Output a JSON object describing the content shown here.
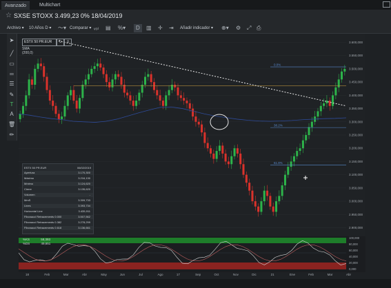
{
  "tabs": [
    {
      "label": "Avanzado",
      "active": true
    },
    {
      "label": "Multichart",
      "active": false
    }
  ],
  "title": "SXSE STOXX 3.499,23 0% 18/04/2019",
  "toolbar": {
    "archivos": "Archivo",
    "periodo": "10 Años D",
    "comparar": "Comparar",
    "indicador": "Añadir indicador",
    "active_tool": "D"
  },
  "legend": {
    "symbol": "ESTX 50 PR.EUR",
    "sma": "SMA (200,0)"
  },
  "panel": {
    "symbol": "ESTX 50 PR.EUR",
    "date": "06/02/2019",
    "rows": [
      {
        "k": "Apertura",
        "v": "3.170,300"
      },
      {
        "k": "Máximo",
        "v": "3.216,130"
      },
      {
        "k": "Mínimo",
        "v": "3.124,620"
      },
      {
        "k": "Cierre",
        "v": "3.135,620"
      },
      {
        "k": "Volumen",
        "v": "-"
      },
      {
        "k": "MmS",
        "v": "3.309,733"
      },
      {
        "k": "Lines",
        "v": "3.393,734"
      },
      {
        "k": "Horizontal Line",
        "v": "3.435,911"
      },
      {
        "k": "Fibonacci Retracements 0.000",
        "v": "3.507,562"
      },
      {
        "k": "Fibonacci Retracements 0.382",
        "v": "3.278,299"
      },
      {
        "k": "Fibonacci Retracements 0.618",
        "v": "3.136,661"
      }
    ]
  },
  "fib_labels": {
    "f0": "0.0%",
    "f382": "38.2%",
    "f618": "61.8%"
  },
  "indicator": {
    "k_label": "%KS",
    "k_value": "58,393",
    "d_label": "%DS",
    "d_value": "49,651"
  },
  "y_ticks": [
    "3.600,000",
    "3.550,000",
    "3.500,000",
    "3.450,000",
    "3.400,000",
    "3.350,000",
    "3.300,000",
    "3.250,000",
    "3.200,000",
    "3.150,000",
    "3.100,000",
    "3.050,000",
    "3.000,000",
    "2.950,000",
    "2.900,000"
  ],
  "ind_ticks": [
    "100,000",
    "80,000",
    "60,000",
    "40,000",
    "20,000",
    "0,000"
  ],
  "x_labels": [
    "18",
    "Feb",
    "Mar",
    "Abr",
    "May",
    "Jun",
    "Jul",
    "Ago",
    "17",
    "Sep",
    "Oct",
    "Nov",
    "Dic",
    "21",
    "Ene",
    "Feb",
    "Mar",
    "Abr"
  ],
  "chart_data": {
    "type": "candlestick",
    "ylim": [
      2870,
      3630
    ],
    "up_color": "#2db34a",
    "down_color": "#d9322b",
    "sma200": [
      3330,
      3325,
      3318,
      3312,
      3308,
      3302,
      3300,
      3298,
      3302,
      3310,
      3322,
      3334,
      3345,
      3355,
      3356,
      3350,
      3340,
      3330,
      3322,
      3316,
      3310,
      3306,
      3303,
      3302,
      3303,
      3305,
      3308,
      3310,
      3312,
      3313,
      3315
    ],
    "sma_x_days": [
      0,
      10,
      20,
      30,
      40,
      50,
      60,
      70,
      80,
      90,
      100,
      110,
      120,
      130,
      140,
      150,
      160,
      170,
      180,
      190,
      200,
      210,
      220,
      230,
      240,
      250,
      260,
      270,
      280,
      290,
      300
    ],
    "fib_levels": {
      "f0": 3507.562,
      "f382": 3278.299,
      "f618": 3136.661
    },
    "horizontal_line": 3435.911,
    "trend_line": [
      [
        3610,
        0
      ],
      [
        3360,
        300
      ]
    ]
  },
  "colors": {
    "accent": "#2b2f33",
    "fib": "#5a8bd0",
    "hline": "#b58f3c",
    "sma": "#2e4b9a",
    "k_line": "#d9d9d9",
    "d_line": "#c06060"
  }
}
